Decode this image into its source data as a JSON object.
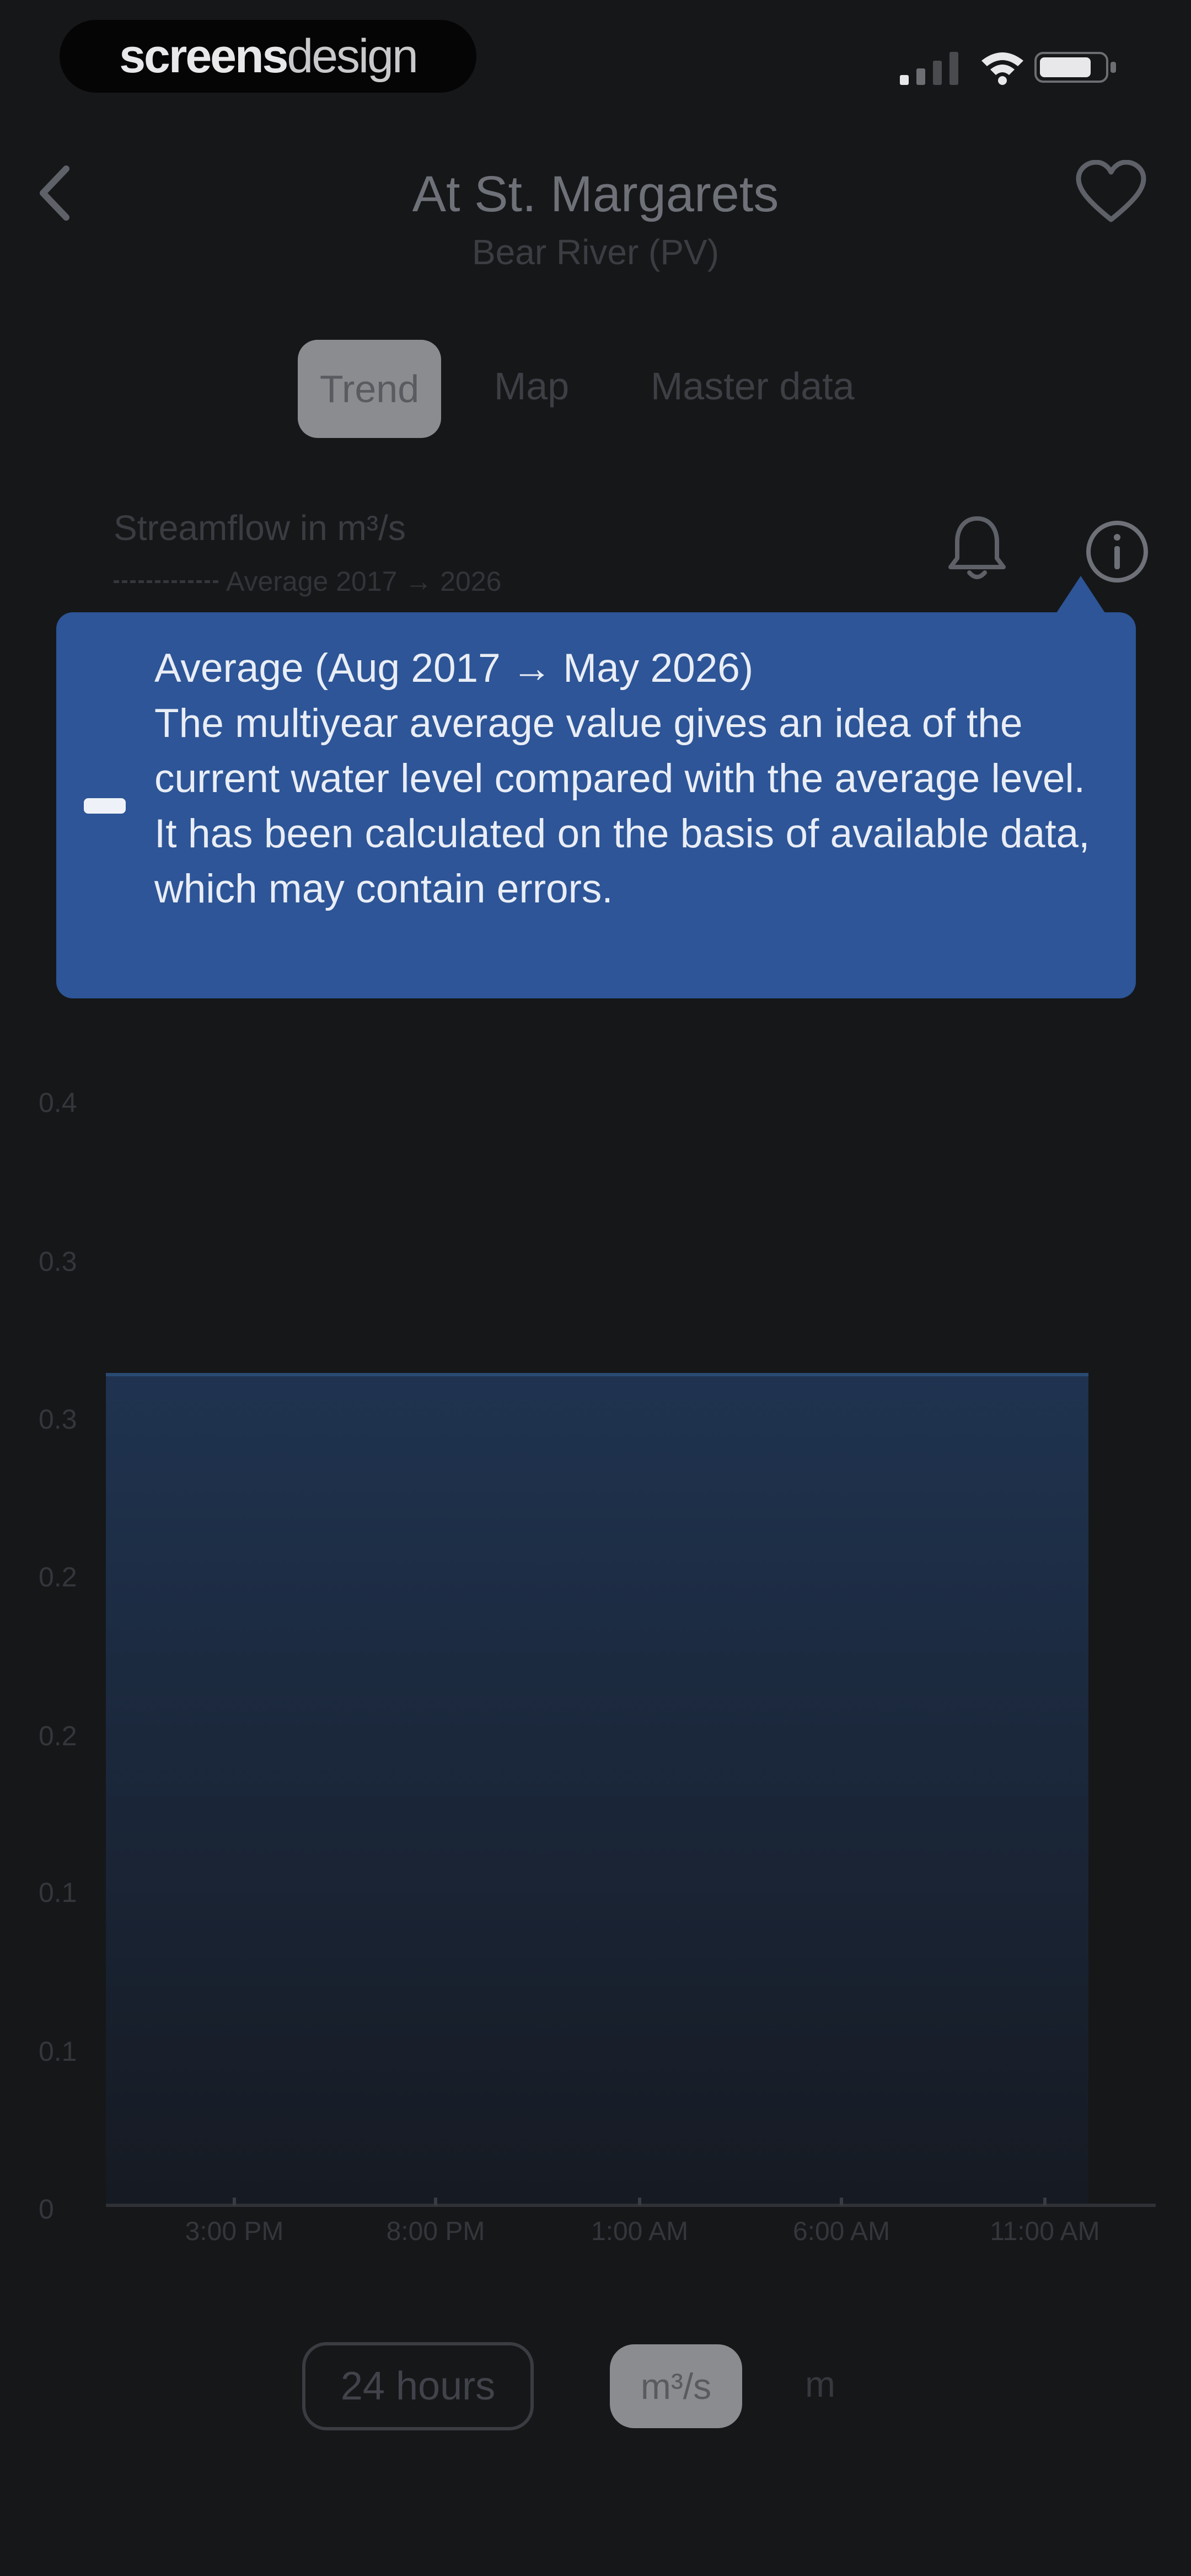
{
  "status_bar": {
    "brand_bold": "screens",
    "brand_light": "design",
    "signal_icon": "signal-icon",
    "wifi_icon": "wifi-icon",
    "battery_icon": "battery-icon"
  },
  "header": {
    "title": "At St. Margarets",
    "subtitle": "Bear River (PV)",
    "back_icon": "chevron-left-icon",
    "favorite_icon": "heart-icon"
  },
  "tabs": [
    {
      "label": "Trend",
      "active": true
    },
    {
      "label": "Map",
      "active": false
    },
    {
      "label": "Master data",
      "active": false
    }
  ],
  "chart_header": {
    "streamflow_label": "Streamflow in m³/s",
    "legend_label": "Average 2017 → 2026",
    "bell_icon": "bell-icon",
    "info_icon": "info-icon"
  },
  "tooltip": {
    "title": "Average (Aug 2017 → May 2026)",
    "body": "The multiyear average value gives an idea of the current water level compared with the average level. It has been calculated on the basis of available data, which may contain errors.",
    "background": "#2d5597"
  },
  "chart_data": {
    "type": "area",
    "title": "",
    "xlabel": "",
    "ylabel": "",
    "y_ticks": [
      "0",
      "0.1",
      "0.1",
      "0.2",
      "0.2",
      "0.3",
      "0.3",
      "0.4"
    ],
    "x_ticks": [
      "3:00 PM",
      "8:00 PM",
      "1:00 AM",
      "6:00 AM",
      "11:00 AM"
    ],
    "series": [
      {
        "values": [
          0.3,
          0.3,
          0.3,
          0.3,
          0.3,
          0.3
        ]
      }
    ],
    "ylim": [
      0,
      0.4
    ],
    "grid": false,
    "fill_color": "#1f3350"
  },
  "controls": {
    "range_label": "24 hours",
    "unit_ms_label": "m³/s",
    "unit_m_label": "m"
  }
}
